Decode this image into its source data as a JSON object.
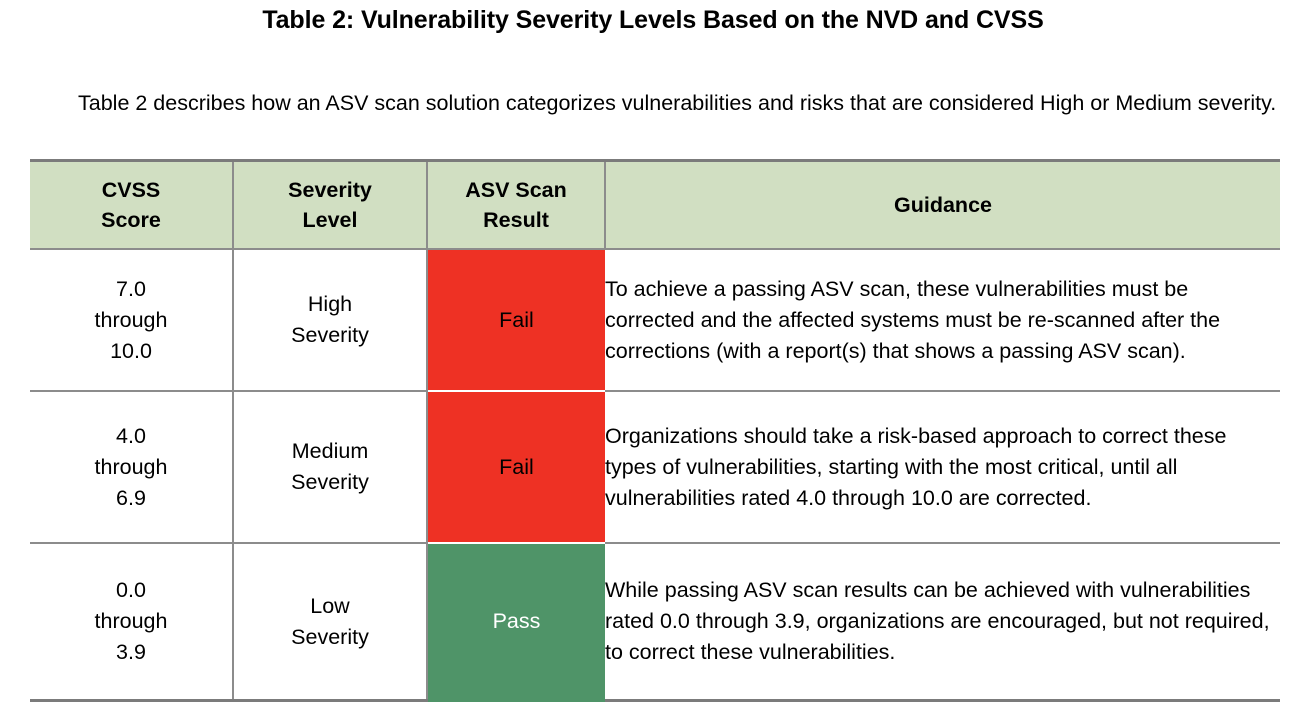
{
  "document": {
    "title": "Table 2: Vulnerability Severity Levels Based on the NVD and CVSS",
    "intro": "Table 2 describes how an ASV scan solution categorizes vulnerabilities and risks that are considered High or Medium severity."
  },
  "colors": {
    "header_background": "#d1dfc2",
    "fail_background": "#ee3124",
    "pass_background": "#4f9468",
    "rule": "#8c8c8c",
    "text": "#000000",
    "pass_text": "#ffffff"
  },
  "table": {
    "headers": {
      "score": "CVSS\nScore",
      "score_line1": "CVSS",
      "score_line2": "Score",
      "severity_line1": "Severity",
      "severity_line2": "Level",
      "result_line1": "ASV Scan",
      "result_line2": "Result",
      "guidance": "Guidance"
    },
    "rows": [
      {
        "score_line1": "7.0",
        "score_line2": "through",
        "score_line3": "10.0",
        "score_range": "7.0 through 10.0",
        "severity_line1": "High",
        "severity_line2": "Severity",
        "severity": "High Severity",
        "result": "Fail",
        "result_state": "fail",
        "guidance": "To achieve a passing ASV scan, these vulnerabilities must be corrected and the affected systems must be re-scanned after the corrections (with a report(s) that shows a passing ASV scan)."
      },
      {
        "score_line1": "4.0",
        "score_line2": "through",
        "score_line3": "6.9",
        "score_range": "4.0 through 6.9",
        "severity_line1": "Medium",
        "severity_line2": "Severity",
        "severity": "Medium Severity",
        "result": "Fail",
        "result_state": "fail",
        "guidance": "Organizations should take a risk-based approach to correct these types of vulnerabilities, starting with the most critical, until all vulnerabilities rated 4.0 through 10.0 are corrected."
      },
      {
        "score_line1": "0.0",
        "score_line2": "through",
        "score_line3": "3.9",
        "score_range": "0.0 through 3.9",
        "severity_line1": "Low",
        "severity_line2": "Severity",
        "severity": "Low Severity",
        "result": "Pass",
        "result_state": "pass",
        "guidance": "While passing ASV scan results can be achieved with vulnerabilities rated 0.0 through 3.9, organizations are encouraged, but not required, to correct these vulnerabilities."
      }
    ]
  }
}
